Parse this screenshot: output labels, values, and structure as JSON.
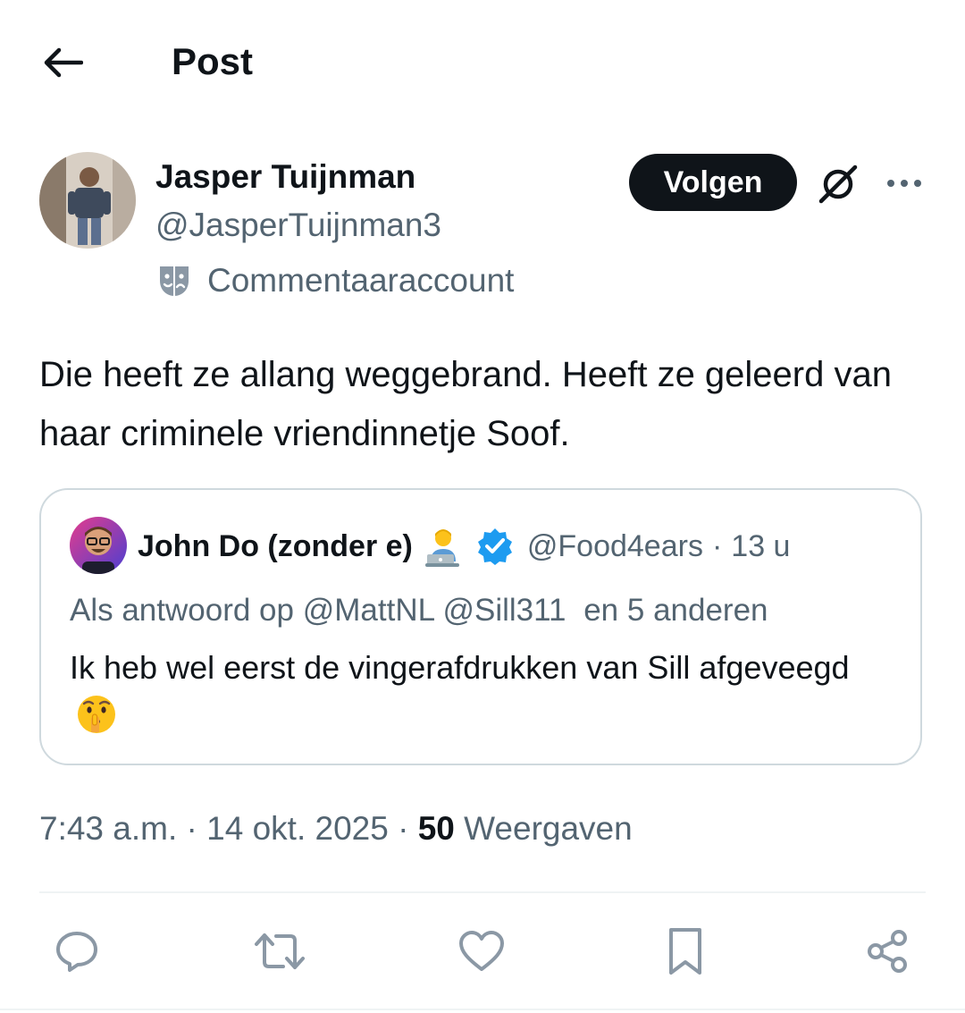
{
  "header": {
    "title": "Post"
  },
  "author": {
    "name": "Jasper Tuijnman",
    "handle": "@JasperTuijnman3",
    "label": "Commentaaraccount",
    "follow_label": "Volgen"
  },
  "post": {
    "text": "Die heeft ze allang weggebrand. Heeft ze geleerd van haar criminele vriendinnetje Soof."
  },
  "quote": {
    "name": "John Do (zonder e)",
    "handle": "@Food4ears",
    "separator": "·",
    "time": "13 u",
    "reply_prefix": "Als antwoord op",
    "reply_mentions": "@MattNL @Sill311",
    "reply_suffix": "en 5 anderen",
    "text": "Ik heb wel eerst de vingerafdrukken van Sill afgeveegd"
  },
  "meta": {
    "time": "7:43 a.m.",
    "date": "14 okt. 2025",
    "separator": "·",
    "views_count": "50",
    "views_label": "Weergaven"
  },
  "colors": {
    "text_primary": "#0f1419",
    "text_secondary": "#536471",
    "border": "#cfd9de",
    "verified": "#1d9bf0"
  },
  "icons": {
    "back": "arrow-left-icon",
    "grok": "grok-icon",
    "more": "more-dots-icon",
    "label": "theater-mask-icon",
    "reply": "reply-icon",
    "retweet": "retweet-icon",
    "like": "heart-icon",
    "bookmark": "bookmark-icon",
    "share": "share-icon"
  }
}
